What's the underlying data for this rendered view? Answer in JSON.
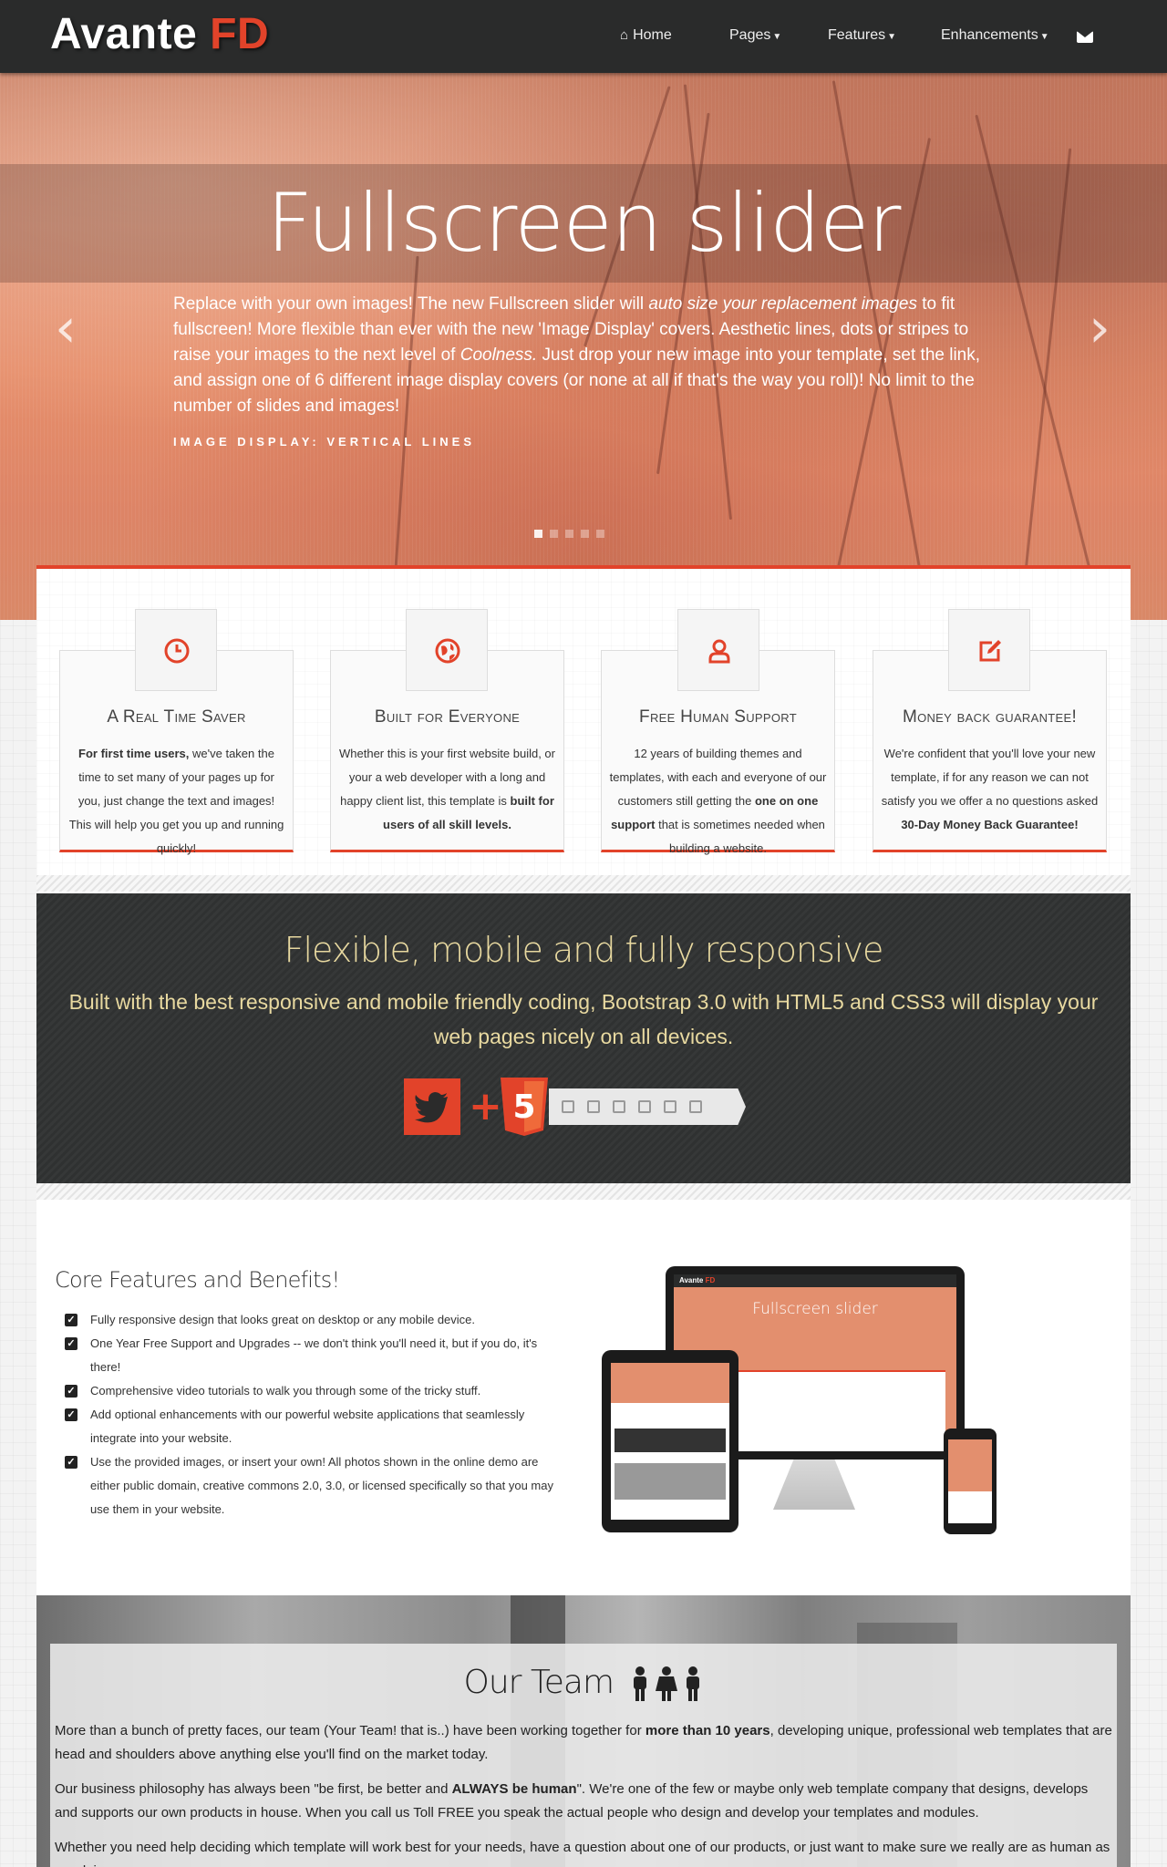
{
  "navbar": {
    "brand_main": "Avante",
    "brand_accent": "FD",
    "items": [
      {
        "label": "Home",
        "icon": "home-icon"
      },
      {
        "label": "Pages"
      },
      {
        "label": "Features"
      },
      {
        "label": "Enhancements"
      }
    ],
    "mail_icon": "envelope-icon"
  },
  "hero": {
    "title": "Fullscreen slider",
    "text_1": "Replace with your own images! The new Fullscreen slider will ",
    "text_em1": "auto size your replacement images",
    "text_2": " to fit fullscreen! More flexible than ever with the new 'Image Display' covers. Aesthetic lines, dots or stripes to raise your images to the next level of ",
    "text_em2": "Coolness.",
    "text_3": " Just drop your new image into your template, set the link, and assign one of 6 different image display covers (or none at all if that's the way you roll)!  No limit to the number of slides and images!",
    "display_label": "IMAGE DISPLAY: VERTICAL LINES",
    "prev_glyph": "‹",
    "next_glyph": "›"
  },
  "features": [
    {
      "title": "A Real Time Saver",
      "icon": "clock-icon",
      "bold_1": "For first time users,",
      "text_1": " we've taken the time to set many of your pages up for you, just change the text and images! This will help you get you up and running quickly!",
      "bold_2": "",
      "text_2": ""
    },
    {
      "title": "Built for Everyone",
      "icon": "globe-icon",
      "bold_1": "",
      "text_1": "Whether this is your first website build, or your a web developer with a long and happy client list, this template is ",
      "bold_2": "built for users of all skill levels.",
      "text_2": ""
    },
    {
      "title": "Free Human Support",
      "icon": "user-icon",
      "bold_1": "",
      "text_1": "12 years of building themes and templates, with each and everyone of our customers still getting the ",
      "bold_2": "one on one support",
      "text_2": " that is sometimes needed when building a website."
    },
    {
      "title": "Money back guarantee!",
      "icon": "edit-icon",
      "bold_1": "",
      "text_1": "We're confident that you'll love your new template, if for any reason we can not satisfy you we offer a no questions asked ",
      "bold_2": "30-Day Money Back Guarantee!",
      "text_2": ""
    }
  ],
  "responsive": {
    "title": "Flexible, mobile and fully responsive",
    "text": "Built with the best responsive and mobile friendly coding, Bootstrap 3.0 with HTML5 and CSS3 will display your web pages nicely on all devices.",
    "plus": "+",
    "html5_label": "5"
  },
  "core": {
    "title": "Core Features and Benefits!",
    "items": [
      "Fully responsive design that looks great on desktop or any mobile device.",
      "One Year Free Support and Upgrades -- we don't think you'll need it, but if you do, it's there!",
      "Comprehensive video tutorials to walk you through some of the tricky stuff.",
      "Add optional enhancements with our powerful website applications that seamlessly integrate into your website.",
      "Use the provided images, or insert your own! All photos shown in the online demo are either public domain, creative commons 2.0, 3.0, or licensed specifically so that you may use them in your website."
    ],
    "devices": {
      "brand_main": "Avante",
      "brand_accent": "FD",
      "screen_title": "Fullscreen slider"
    }
  },
  "team": {
    "title": "Our Team",
    "p1_a": "More than a bunch of pretty faces, our team (Your Team! that is..) have been working together for ",
    "p1_b": "more than 10 years",
    "p1_c": ", developing unique, professional web templates that are head and shoulders above anything else you'll find on the market today.",
    "p2_a": "Our business philosophy has always been \"be first, be better and ",
    "p2_b": "ALWAYS be human",
    "p2_c": "\". We're one of the few or maybe only web template company that designs, develops and supports our own products in house. When you call us Toll FREE you speak the actual people who design and develop your templates and modules.",
    "p3": "Whether you need help deciding which template will work best for your needs, have a question about one of our products, or just want to make sure we really are as human as we claim..."
  },
  "colors": {
    "accent": "#e2432a",
    "navbar": "#2a2b2b",
    "band_text": "#e8d9a0"
  }
}
